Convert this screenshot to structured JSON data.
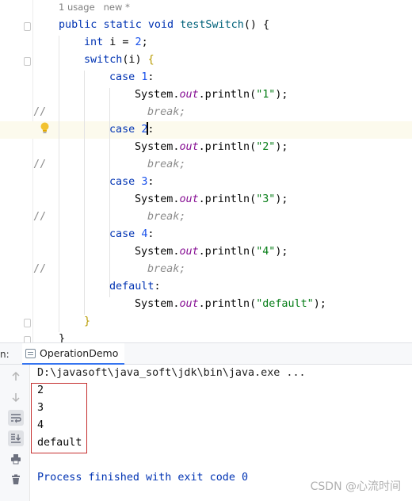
{
  "editor": {
    "inlay_hints": "1 usage   new *",
    "comment_prefix": "//",
    "lines": {
      "method_sig": {
        "kw1": "public",
        "kw2": "static",
        "kw3": "void",
        "name": "testSwitch",
        "rest": "() {"
      },
      "decl": {
        "kw": "int",
        "text": " i = ",
        "num": "2",
        "end": ";"
      },
      "switch": {
        "kw": "switch",
        "paren": "(i) ",
        "brace": "{"
      },
      "case1": {
        "kw": "case",
        "num": "1",
        "end": ":"
      },
      "print1": {
        "pre": "System.",
        "field": "out",
        "mid": ".println(",
        "str": "\"1\"",
        "end": ");"
      },
      "break1": "break;",
      "case2": {
        "kw": "case",
        "num": "2",
        "end": ":"
      },
      "print2": {
        "pre": "System.",
        "field": "out",
        "mid": ".println(",
        "str": "\"2\"",
        "end": ");"
      },
      "break2": "break;",
      "case3": {
        "kw": "case",
        "num": "3",
        "end": ":"
      },
      "print3": {
        "pre": "System.",
        "field": "out",
        "mid": ".println(",
        "str": "\"3\"",
        "end": ");"
      },
      "break3": "break;",
      "case4": {
        "kw": "case",
        "num": "4",
        "end": ":"
      },
      "print4": {
        "pre": "System.",
        "field": "out",
        "mid": ".println(",
        "str": "\"4\"",
        "end": ");"
      },
      "break4": "break;",
      "default": {
        "kw": "default",
        "end": ":"
      },
      "print_default": {
        "pre": "System.",
        "field": "out",
        "mid": ".println(",
        "str": "\"default\"",
        "end": ");"
      },
      "close_switch": "}",
      "close_method": "}"
    }
  },
  "run_panel": {
    "label": "n:",
    "tab_label": "OperationDemo",
    "command": "D:\\javasoft\\java_soft\\jdk\\bin\\java.exe ...",
    "output": [
      "2",
      "3",
      "4",
      "default"
    ],
    "exit_message": "Process finished with exit code 0",
    "toolbar_icons": [
      "arrow-up-icon",
      "arrow-down-icon",
      "soft-wrap-icon",
      "scroll-to-end-icon",
      "print-icon",
      "trash-icon"
    ]
  },
  "watermark": "CSDN @心流时间",
  "colors": {
    "keyword": "#0033b3",
    "string": "#067d17",
    "number": "#1750eb",
    "field": "#871094",
    "comment": "#8c8c8c",
    "highlight_box": "#c53030"
  }
}
